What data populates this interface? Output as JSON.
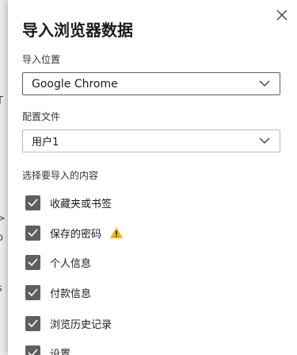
{
  "dialog": {
    "title": "导入浏览器数据",
    "import_from_label": "导入位置",
    "import_from_value": "Google Chrome",
    "profile_label": "配置文件",
    "profile_value": "用户1",
    "items_label": "选择要导入的内容",
    "options": [
      {
        "label": "收藏夹或书签",
        "checked": true
      },
      {
        "label": "保存的密码",
        "checked": true,
        "warning": true
      },
      {
        "label": "个人信息",
        "checked": true
      },
      {
        "label": "付款信息",
        "checked": true
      },
      {
        "label": "浏览历史记录",
        "checked": true
      },
      {
        "label": "设置",
        "checked": true
      }
    ]
  },
  "colors": {
    "checkbox": "#5f5f5f",
    "warning": "#f0b400",
    "text": "#1b1b1b"
  },
  "icons": {
    "close": "close-icon",
    "chevron": "chevron-down-icon",
    "check": "checkmark-icon",
    "warning": "warning-icon"
  }
}
